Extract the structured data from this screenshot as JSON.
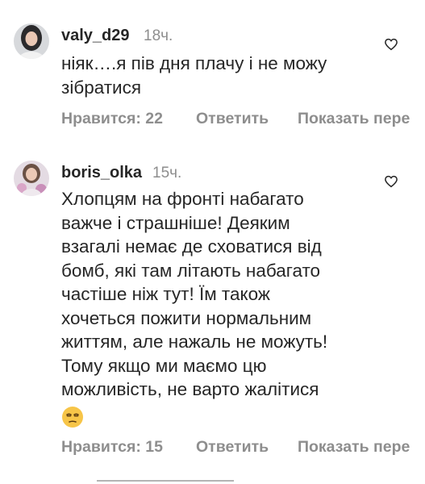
{
  "comments": [
    {
      "username": "valy_d29",
      "time": "18ч.",
      "text": "ніяк….я пів дня плачу і не можу\nзібратися",
      "likes_label": "Нравится: 22",
      "reply_label": "Ответить",
      "translate_label": "Показать пере"
    },
    {
      "username": "boris_olka",
      "time": "15ч.",
      "text": "Хлопцям на фронті набагато\nважче і страшніше! Деяким\nвзагалі немає де сховатися від\nбомб, які там літають набагато\nчастіше ніж тут! Їм також\nхочеться пожити нормальним\nжиттям, але нажаль не можуть!\nТому якщо ми маємо цю\nможливість, не варто жалітися",
      "emoji": "unamused-face-emoji",
      "likes_label": "Нравится: 15",
      "reply_label": "Ответить",
      "translate_label": "Показать пере"
    }
  ],
  "colors": {
    "text": "#262626",
    "secondary": "#8e8e8e"
  },
  "icons": [
    "heart-icon",
    "unamused-face-emoji"
  ]
}
